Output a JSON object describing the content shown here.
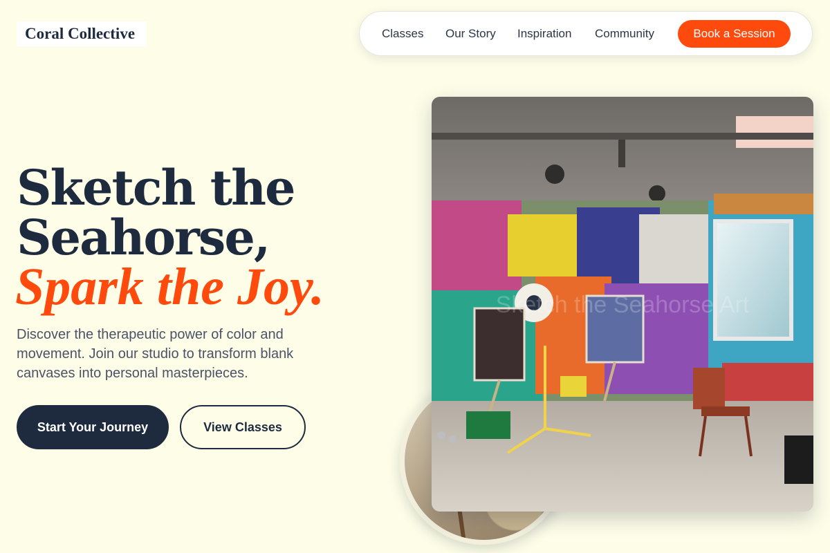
{
  "brand": {
    "name": "Coral Collective"
  },
  "nav": {
    "links": [
      "Classes",
      "Our Story",
      "Inspiration",
      "Community"
    ],
    "cta_label": "Book a Session"
  },
  "hero": {
    "title_line1": "Sketch the",
    "title_line2": "Seahorse,",
    "title_accent": "Spark the Joy.",
    "description": "Discover the therapeutic power of color and movement. Join our studio to transform blank canvases into personal masterpieces.",
    "primary_button": "Start Your Journey",
    "secondary_button": "View Classes",
    "image_caption": "Sketch the Seahorse Art"
  },
  "colors": {
    "background": "#fdfde8",
    "navy": "#1e2a3e",
    "accent": "#ff4a0d"
  },
  "icons": {
    "studio_photo": "art-studio-photo",
    "secondary_photo": "studio-detail-photo"
  }
}
